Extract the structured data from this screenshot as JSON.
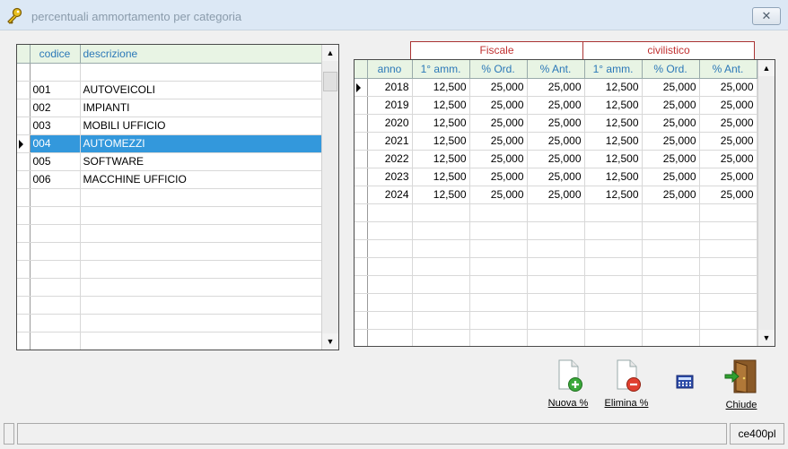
{
  "window": {
    "title": "percentuali ammortamento per categoria",
    "close_label": "✕"
  },
  "categories": {
    "headers": {
      "codice": "codice",
      "descrizione": "descrizione"
    },
    "rows": [
      {
        "codice": "",
        "descrizione": ""
      },
      {
        "codice": "001",
        "descrizione": "AUTOVEICOLI"
      },
      {
        "codice": "002",
        "descrizione": "IMPIANTI"
      },
      {
        "codice": "003",
        "descrizione": "MOBILI UFFICIO"
      },
      {
        "codice": "004",
        "descrizione": "AUTOMEZZI"
      },
      {
        "codice": "005",
        "descrizione": "SOFTWARE"
      },
      {
        "codice": "006",
        "descrizione": "MACCHINE UFFICIO"
      }
    ],
    "selected_codice": "004"
  },
  "rates": {
    "groups": {
      "fiscale": "Fiscale",
      "civilistico": "civilistico"
    },
    "headers": [
      "anno",
      "1° amm.",
      "% Ord.",
      "% Ant.",
      "1° amm.",
      "% Ord.",
      "% Ant."
    ],
    "rows": [
      [
        "2018",
        "12,500",
        "25,000",
        "25,000",
        "12,500",
        "25,000",
        "25,000"
      ],
      [
        "2019",
        "12,500",
        "25,000",
        "25,000",
        "12,500",
        "25,000",
        "25,000"
      ],
      [
        "2020",
        "12,500",
        "25,000",
        "25,000",
        "12,500",
        "25,000",
        "25,000"
      ],
      [
        "2021",
        "12,500",
        "25,000",
        "25,000",
        "12,500",
        "25,000",
        "25,000"
      ],
      [
        "2022",
        "12,500",
        "25,000",
        "25,000",
        "12,500",
        "25,000",
        "25,000"
      ],
      [
        "2023",
        "12,500",
        "25,000",
        "25,000",
        "12,500",
        "25,000",
        "25,000"
      ],
      [
        "2024",
        "12,500",
        "25,000",
        "25,000",
        "12,500",
        "25,000",
        "25,000"
      ]
    ],
    "current_year": "2018"
  },
  "toolbar": {
    "nuova_label": "Nuova %",
    "elimina_label": "Elimina %",
    "chiude_label": "Chiude"
  },
  "status": {
    "code": "ce400pl"
  },
  "colors": {
    "selection": "#3398dc",
    "header_bg": "#e8f4e4",
    "header_text": "#2b78b8",
    "group_text": "#c03030"
  }
}
